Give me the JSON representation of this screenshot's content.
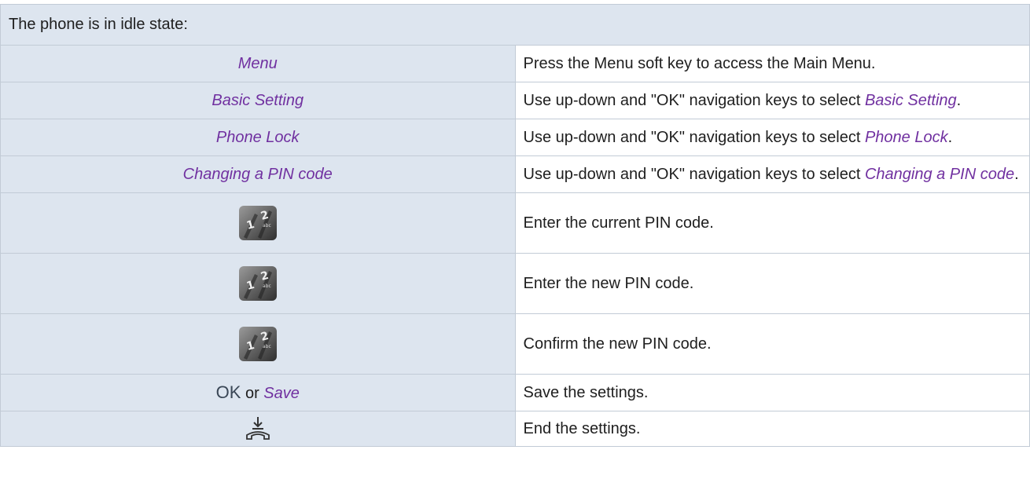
{
  "header": "The phone is in idle state:",
  "steps": [
    {
      "left": "Menu",
      "right": "Press the Menu soft key to access the Main Menu."
    },
    {
      "left": "Basic Setting",
      "right_prefix": "Use up-down and \"OK\" navigation keys to select ",
      "right_em": "Basic Setting",
      "right_suffix": "."
    },
    {
      "left": "Phone Lock",
      "right_prefix": "Use up-down and \"OK\" navigation keys to select ",
      "right_em": "Phone Lock",
      "right_suffix": "."
    },
    {
      "left": "Changing a PIN code",
      "right_prefix": "Use up-down and \"OK\" navigation keys to select ",
      "right_em": "Changing a PIN code",
      "right_suffix": "."
    },
    {
      "icon": "keypad-icon",
      "right": "Enter the current PIN code."
    },
    {
      "icon": "keypad-icon",
      "right": "Enter the new PIN code."
    },
    {
      "icon": "keypad-icon",
      "right": "Confirm the new PIN code."
    },
    {
      "left_ok": "OK",
      "left_or": " or ",
      "left_save": "Save",
      "right": "Save the settings."
    },
    {
      "icon": "hang-up-icon",
      "right": "End the settings."
    }
  ]
}
